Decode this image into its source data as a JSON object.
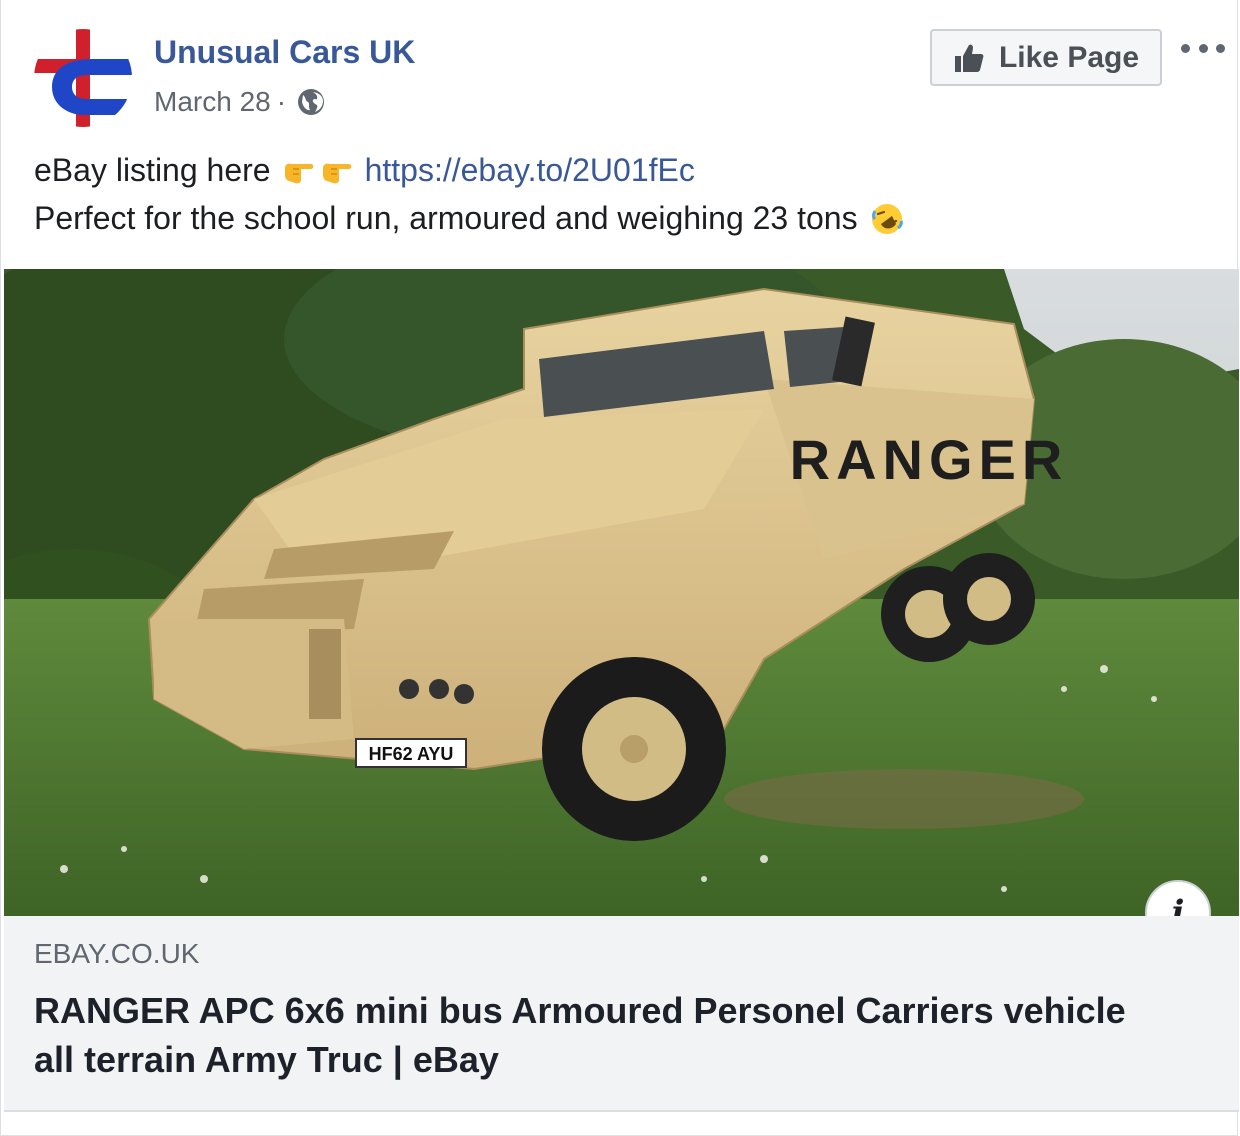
{
  "post": {
    "page_name": "Unusual Cars UK",
    "date": "March 28",
    "separator": "·",
    "like_label": "Like Page",
    "line1_text": "eBay listing here",
    "line1_emoji": "point-right-emoji point-right-emoji",
    "link": "https://ebay.to/2U01fEc",
    "line2_text": "Perfect for the school run, armoured and weighing 23 tons",
    "line2_emoji": "rolling-laughing-emoji"
  },
  "photo": {
    "vehicle_text": "RANGER",
    "plate": "HF62 AYU"
  },
  "link_preview": {
    "domain": "EBAY.CO.UK",
    "title": "RANGER APC 6x6 mini bus Armoured Personel Carriers vehicle all terrain Army Truc | eBay",
    "info_label": "i"
  },
  "colors": {
    "link": "#385898",
    "vehicle": "#dcc48e",
    "caption_bg": "#f2f3f5"
  }
}
